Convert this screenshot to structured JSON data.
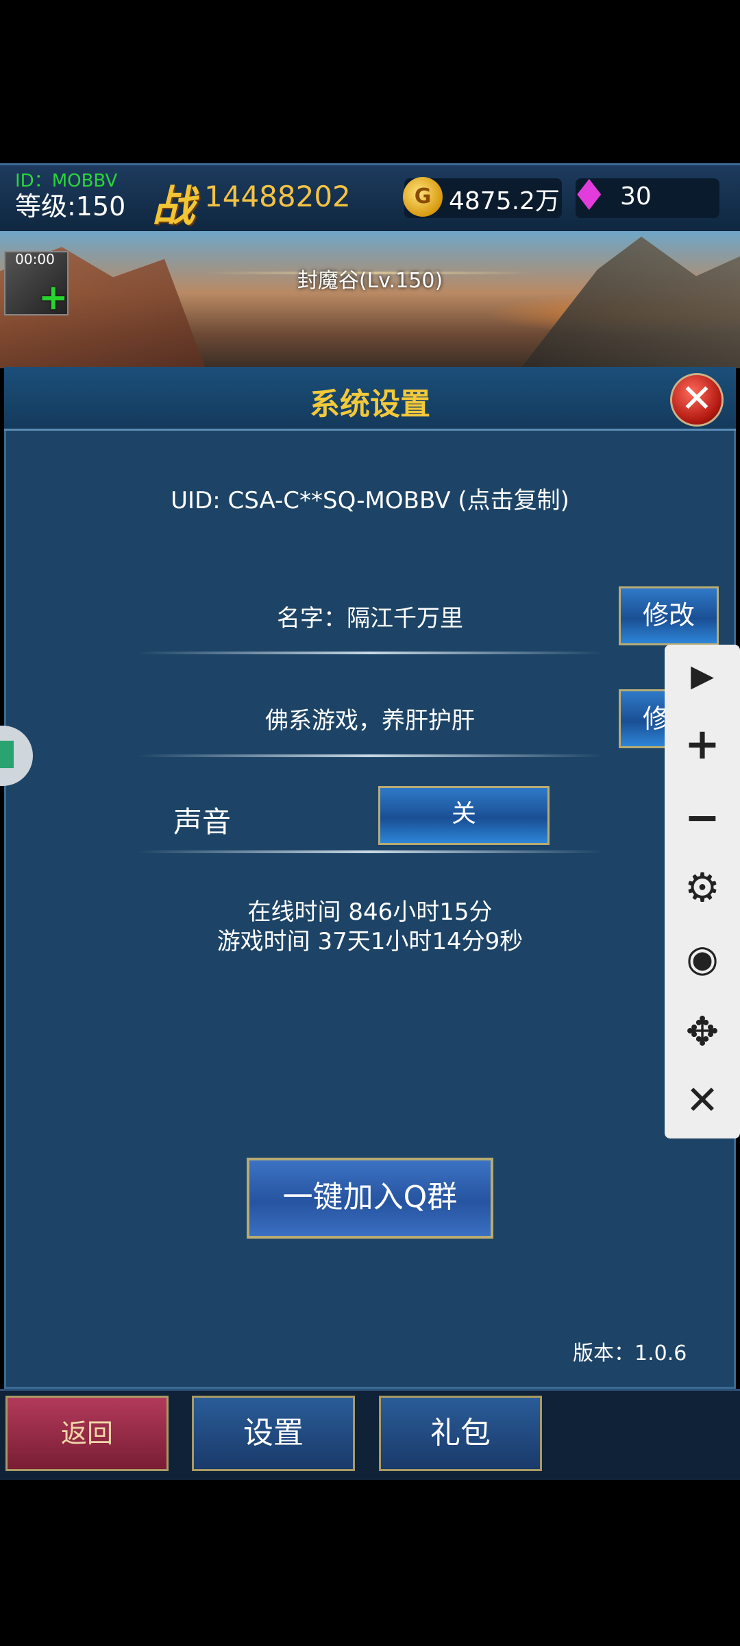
{
  "top_bar": {
    "id_text": "ID：MOBBV",
    "level_text": "等级:150",
    "power_icon": "战",
    "power_value": "14488202",
    "gold_icon_letter": "G",
    "gold_value": "4875.2万",
    "gem_value": "30"
  },
  "scene": {
    "map_name": "封魔谷(Lv.150)",
    "buff_timer": "00:00"
  },
  "dialog": {
    "title": "系统设置",
    "uid_text": "UID: CSA-C**SQ-MOBBV (点击复制)",
    "name_label": "名字：隔江千万里",
    "edit_name_button": "修改",
    "signature_label": "佛系游戏，养肝护肝",
    "edit_signature_button": "修改",
    "sound_label": "声音",
    "sound_toggle": "关",
    "online_time": "在线时间 846小时15分",
    "play_time": "游戏时间 37天1小时14分9秒",
    "join_qq_button": "一键加入Q群",
    "version": "版本：1.0.6"
  },
  "bottom_nav": {
    "back": "返回",
    "settings": "设置",
    "gift": "礼包"
  },
  "tool_panel": {
    "icons": [
      "play-icon",
      "plus-icon",
      "minus-icon",
      "gear-icon",
      "eye-icon",
      "move-icon",
      "close-icon"
    ]
  }
}
